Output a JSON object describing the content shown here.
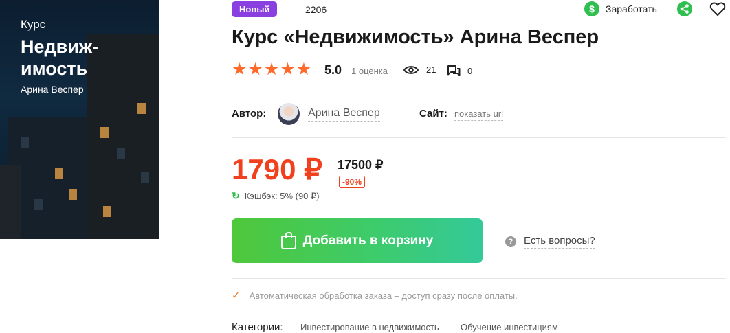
{
  "cover": {
    "kurs": "Курс",
    "title": "Недвиж-имость",
    "author": "Арина Веспер"
  },
  "badge": "Новый",
  "code": "2206",
  "earn_label": "Заработать",
  "icons": {
    "earn": "dollar-coin-icon",
    "share": "share-icon",
    "favorite": "heart-icon",
    "views": "eye-icon",
    "comments": "comment-icon",
    "cashback": "refresh-icon",
    "cart": "shopping-bag-icon",
    "questions": "question-icon",
    "auto": "check-icon"
  },
  "title": "Курс «Недвижимость» Арина Веспер",
  "rating": {
    "stars": 5,
    "value": "5.0",
    "count_text": "1 оценка"
  },
  "views": "21",
  "comments": "0",
  "author": {
    "label": "Автор:",
    "name": "Арина Веспер"
  },
  "site": {
    "label": "Сайт:",
    "link": "показать url"
  },
  "price": {
    "current": "1790 ₽",
    "old": "17500 ₽",
    "discount": "-90%",
    "cashback": "Кэшбэк: 5% (90 ₽)"
  },
  "cart_button": "Добавить в корзину",
  "questions": "Есть вопросы?",
  "auto_text": "Автоматическая обработка заказа – доступ сразу после оплаты.",
  "categories": {
    "label": "Категории:",
    "items": [
      "Инвестирование в недвижимость",
      "Обучение инвестициям"
    ]
  },
  "colors": {
    "accent_price": "#f0401e",
    "badge": "#8a3fe0",
    "green": "#2fbf4f",
    "star": "#ff6a2b"
  }
}
